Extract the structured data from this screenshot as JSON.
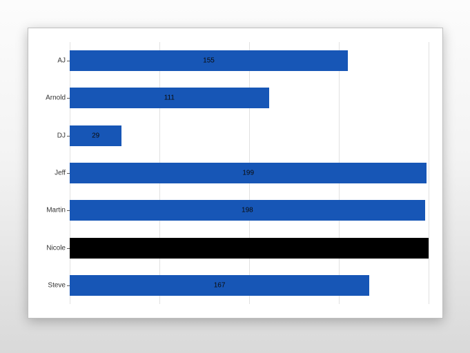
{
  "chart_data": {
    "type": "bar",
    "orientation": "horizontal",
    "categories": [
      "AJ",
      "Arnold",
      "DJ",
      "Jeff",
      "Martin",
      "Nicole",
      "Steve"
    ],
    "values": [
      155,
      111,
      29,
      199,
      198,
      200,
      167
    ],
    "value_labels": [
      "155",
      "111",
      "29",
      "199",
      "198",
      "",
      "167"
    ],
    "highlight_index": 5,
    "title": "",
    "xlabel": "",
    "ylabel": "",
    "xlim": [
      0,
      200
    ],
    "x_ticks": [
      0,
      50,
      100,
      150,
      200
    ],
    "colors": {
      "bar": "#1756B6",
      "highlight": "#000000"
    }
  }
}
